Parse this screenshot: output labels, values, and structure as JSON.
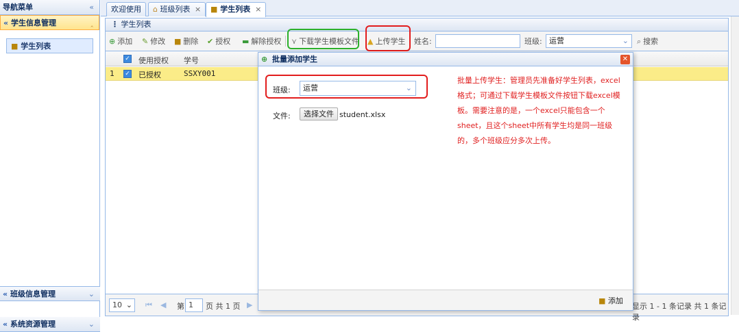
{
  "sidebar": {
    "title": "导航菜单",
    "collapse_icon": "«",
    "sections": [
      {
        "label": "学生信息管理",
        "toggle": "^"
      },
      {
        "label": "班级信息管理",
        "toggle": "v"
      },
      {
        "label": "系统资源管理",
        "toggle": "v"
      }
    ],
    "items": [
      {
        "label": "学生列表"
      }
    ],
    "section_prefix": "«"
  },
  "tabs": [
    {
      "label": "欢迎使用"
    },
    {
      "label": "班级列表",
      "close": "×"
    },
    {
      "label": "学生列表",
      "close": "×"
    }
  ],
  "panel": {
    "title": "学生列表"
  },
  "toolbar": {
    "add": "添加",
    "edit": "修改",
    "delete": "删除",
    "authorize": "授权",
    "revoke": "解除授权",
    "download_template": "下载学生模板文件",
    "upload": "上传学生",
    "name_label": "姓名:",
    "name_value": "",
    "class_label": "班级:",
    "class_value": "运营",
    "search": "搜索"
  },
  "grid": {
    "columns": [
      "使用授权",
      "学号"
    ],
    "rows": [
      {
        "index": "1",
        "auth": "已授权",
        "student_no": "SSXY001"
      }
    ]
  },
  "pager": {
    "page_size": "10",
    "page_prefix": "第",
    "page_value": "1",
    "page_suffix": "页 共 1 页",
    "summary": "显示 1 - 1 条记录 共 1 条记录"
  },
  "dialog": {
    "title": "批量添加学生",
    "class_label": "班级:",
    "class_value": "运营",
    "file_label": "文件:",
    "file_button": "选择文件",
    "file_name": "student.xlsx",
    "note": "批量上传学生：管理员先准备好学生列表，excel格式；可通过下载学生模板文件按钮下载excel模板。需要注意的是，一个excel只能包含一个sheet，且这个sheet中所有学生均是同一班级的，多个班级应分多次上传。",
    "add_button": "添加"
  },
  "colors": {
    "border": "#95b8e7",
    "highlight_row": "#fbec88",
    "annotation_red": "#e21c1c",
    "annotation_green": "#2bb02b",
    "note_text": "#e02020"
  }
}
